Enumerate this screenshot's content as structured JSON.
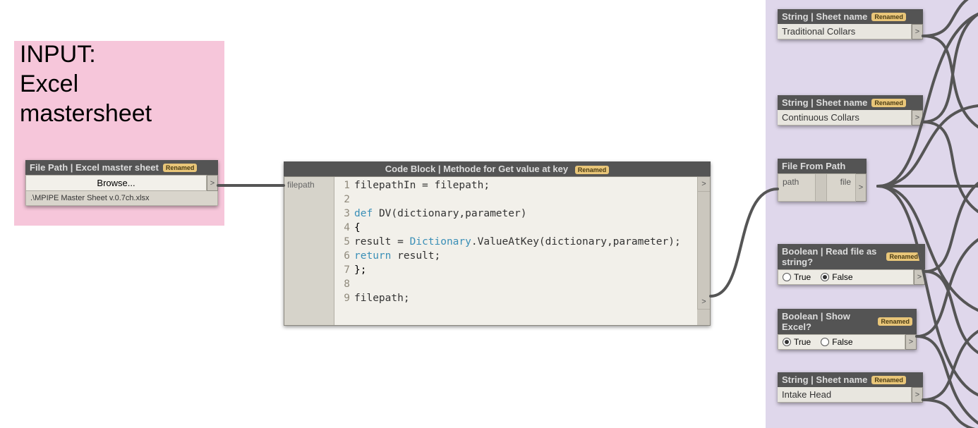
{
  "ui": {
    "renamed": "Renamed",
    "true": "True",
    "false": "False"
  },
  "group": {
    "line1": "INPUT:",
    "line2": "Excel",
    "line3": "mastersheet"
  },
  "filePath": {
    "title": "File Path | Excel master sheet",
    "browse": "Browse...",
    "value": ".\\MPIPE Master Sheet v.0.7ch.xlsx"
  },
  "codeBlock": {
    "title": "Code Block | Methode for Get value at key",
    "inPort": "filepath",
    "kw_def": "def",
    "kw_return": "return",
    "l3rest": "DV(dictionary,parameter)",
    "l5a": "result = ",
    "l5b": "Dictionary",
    "l5c": ".ValueAtKey(dictionary,parameter);",
    "l6rest": "result;",
    "lines": [
      "filepathIn = filepath;",
      "",
      "def DV(dictionary,parameter)",
      "{",
      "result = Dictionary.ValueAtKey(dictionary,parameter);",
      "return result;",
      "};",
      "",
      "filepath;"
    ]
  },
  "sheet1": {
    "title": "String | Sheet name",
    "value": "Traditional Collars"
  },
  "sheet2": {
    "title": "String | Sheet name",
    "value": "Continuous Collars"
  },
  "sheet3": {
    "title": "String | Sheet name",
    "value": "Intake Head"
  },
  "fileFromPath": {
    "title": "File From Path",
    "in": "path",
    "out": "file"
  },
  "boolRead": {
    "title": "Boolean | Read file as string?",
    "value": false
  },
  "boolShow": {
    "title": "Boolean | Show Excel?",
    "value": true
  }
}
